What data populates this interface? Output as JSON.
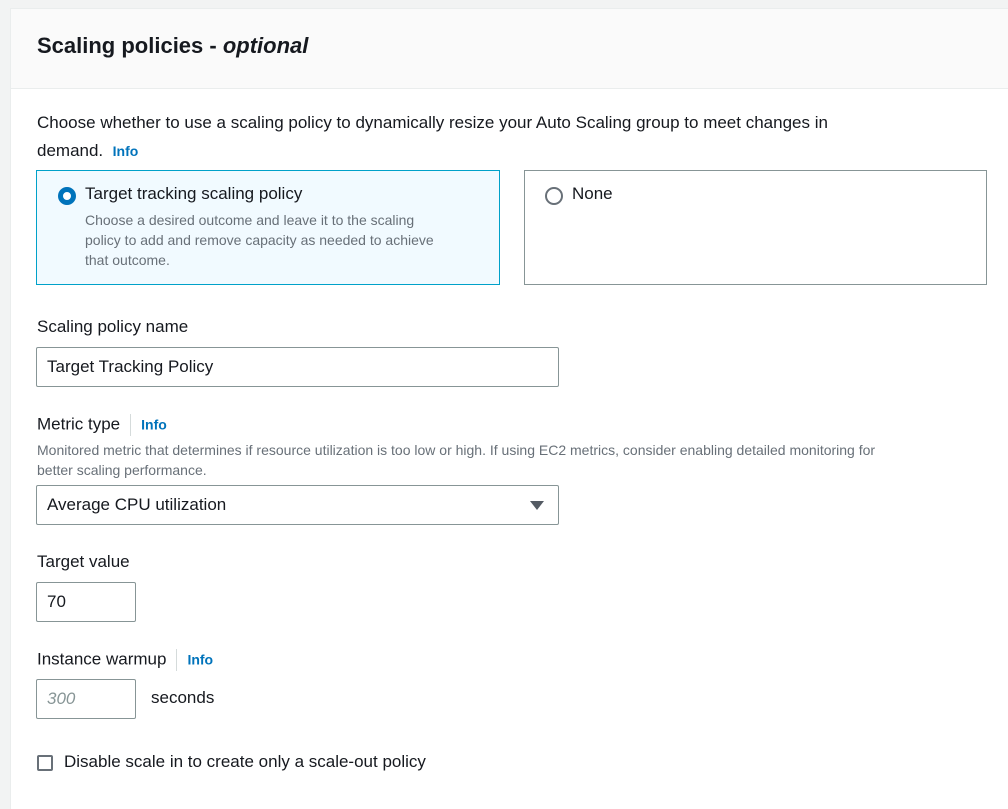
{
  "section": {
    "title": "Scaling policies - ",
    "title_suffix": "optional"
  },
  "intro": {
    "line1": "Choose whether to use a scaling policy to dynamically resize your Auto Scaling group to meet changes in",
    "line2": "demand.",
    "info": "Info"
  },
  "policy_options": [
    {
      "title": "Target tracking scaling policy",
      "description": [
        "Choose a desired outcome and leave it to the scaling",
        "policy to add and remove capacity as needed to achieve",
        "that outcome."
      ],
      "selected": true
    },
    {
      "title": "None",
      "selected": false
    }
  ],
  "policy_name": {
    "label": "Scaling policy name",
    "value": "Target Tracking Policy"
  },
  "metric_type": {
    "label": "Metric type",
    "info": "Info",
    "hint_line1": "Monitored metric that determines if resource utilization is too low or high. If using EC2 metrics, consider enabling detailed monitoring for",
    "hint_line2": "better scaling performance.",
    "selected": "Average CPU utilization"
  },
  "target_value": {
    "label": "Target value",
    "value": "70"
  },
  "instance_warmup": {
    "label": "Instance warmup",
    "info": "Info",
    "placeholder": "300",
    "unit": "seconds"
  },
  "disable_scale_in": {
    "label": "Disable scale in to create only a scale-out policy",
    "checked": false
  },
  "colors": {
    "accent": "#0073bb",
    "selected_border": "#00a1c9",
    "selected_bg": "#f1faff",
    "header_bg": "#fafafa"
  }
}
